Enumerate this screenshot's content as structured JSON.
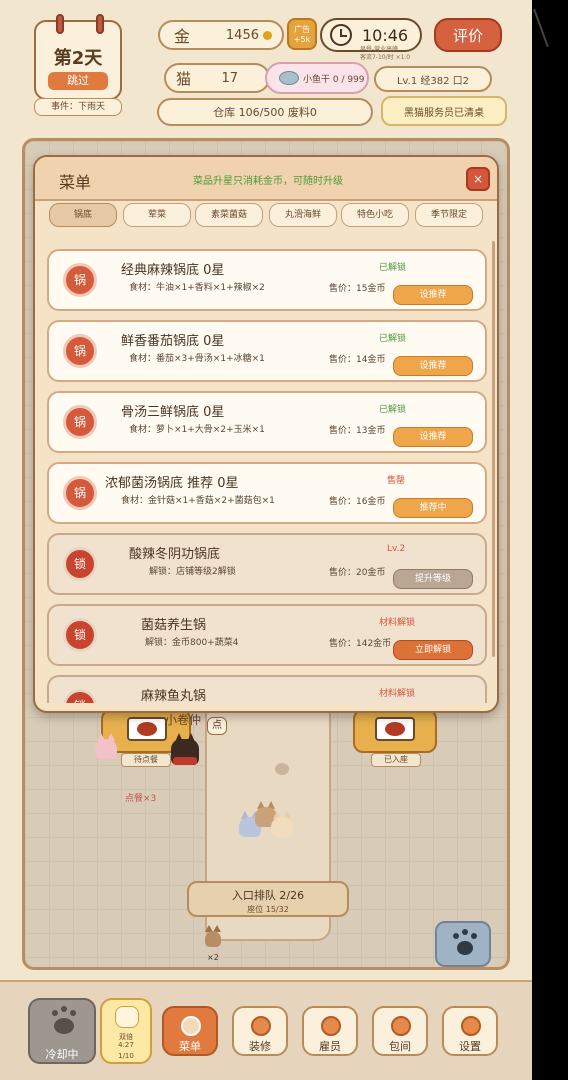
{
  "calendar": {
    "day": "第2天",
    "skip": "跳过",
    "event": "事件：下雨天"
  },
  "gold": {
    "label": "金",
    "value": "1456"
  },
  "ad": {
    "line1": "广告",
    "line2": "+5k"
  },
  "clock": {
    "time": "10:46",
    "sub1": "早餐-营业高峰",
    "sub2": "客流7-10/时 ×1.0"
  },
  "rate_button": "评价",
  "cat_count": {
    "label": "猫",
    "value": "17"
  },
  "fish": {
    "label": "小鱼干 0 / 999"
  },
  "level": {
    "text": "Lv.1  经382  口2"
  },
  "warehouse": {
    "text": "仓库 106/500  废料0"
  },
  "notice": {
    "text": "黑猫服务员已清桌"
  },
  "menu": {
    "title": "菜单",
    "hint": "菜品升星只消耗金币，可随时升级",
    "close": "×",
    "tabs": [
      "锅底",
      "荤菜",
      "素菜菌菇",
      "丸滑海鲜",
      "特色小吃",
      "季节限定"
    ],
    "items": [
      {
        "icon": "锅",
        "name": "经典麻辣锅底  0星",
        "desc": "食材：牛油×1+香料×1+辣椒×2",
        "status": "已解锁",
        "price": "售价：15金币",
        "button": "设推荐"
      },
      {
        "icon": "锅",
        "name": "鲜香番茄锅底  0星",
        "desc": "食材：番茄×3+骨汤×1+冰糖×1",
        "status": "已解锁",
        "price": "售价：14金币",
        "button": "设推荐"
      },
      {
        "icon": "锅",
        "name": "骨汤三鲜锅底  0星",
        "desc": "食材：萝卜×1+大骨×2+玉米×1",
        "status": "已解锁",
        "price": "售价：13金币",
        "button": "设推荐"
      },
      {
        "icon": "锅",
        "name": "浓郁菌汤锅底  推荐  0星",
        "desc": "食材：金针菇×1+香菇×2+菌菇包×1",
        "status": "售罄",
        "price": "售价：16金币",
        "button": "推荐中"
      },
      {
        "icon": "锁",
        "name": "酸辣冬阴功锅底",
        "desc": "解锁：店铺等级2解锁",
        "status": "Lv.2",
        "price": "售价：20金币",
        "button": "提升等级"
      },
      {
        "icon": "锁",
        "name": "菌菇养生锅",
        "desc": "解锁：金币800+蔬菜4",
        "status": "材料解锁",
        "price": "售价：142金币",
        "button": "立即解锁"
      },
      {
        "icon": "锁",
        "name": "麻辣鱼丸锅",
        "desc": "",
        "status": "材料解锁",
        "price": "",
        "button": ""
      }
    ]
  },
  "scene": {
    "shop_sign": "小卷仲",
    "order_bubble": "点",
    "table_left_label": "待点餐",
    "table_right_label": "已入座",
    "order_count": "点餐×3",
    "queue_title": "入口排队 2/26",
    "queue_sub": "座位 15/32",
    "small_count": "×2"
  },
  "bottom": {
    "cooldown": "冷却中",
    "double": {
      "line1": "双倍",
      "line2": "4:27",
      "line3": "1/10"
    },
    "nav": [
      "菜单",
      "装修",
      "雇员",
      "包间",
      "设置"
    ]
  },
  "colors": {
    "accent": "#e07a3e",
    "status_green": "#4c9a3c",
    "status_red": "#d4563b",
    "panel": "#f5e3c8"
  }
}
